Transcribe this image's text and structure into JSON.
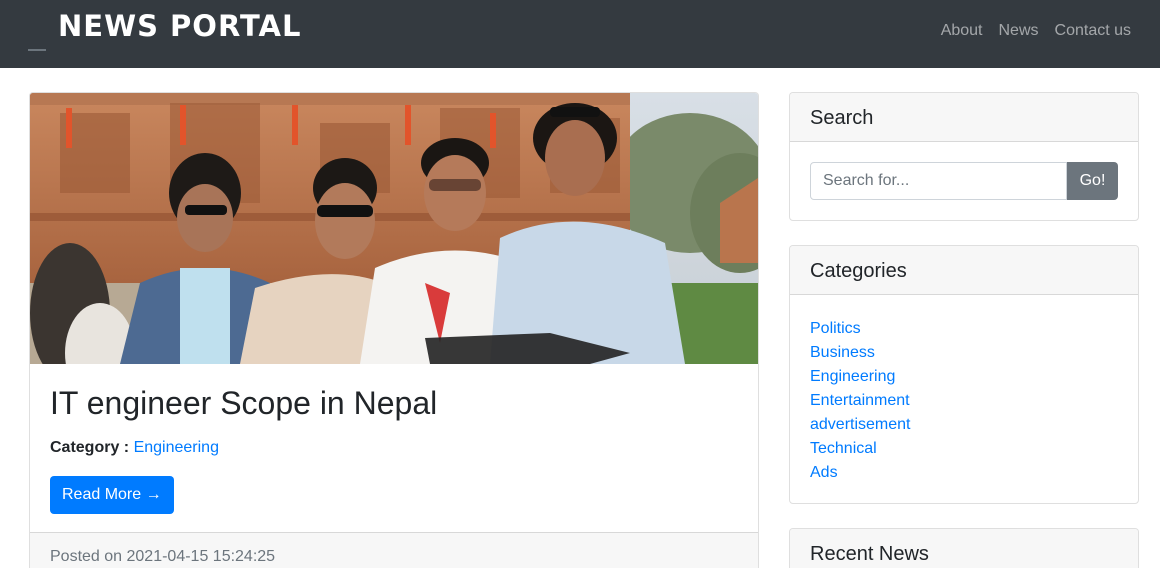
{
  "navbar": {
    "brand": "NEWS PORTAL",
    "links": [
      "About",
      "News",
      "Contact us"
    ]
  },
  "post": {
    "image": "group-photo-four-men-in-front-of-temple",
    "title": "IT engineer Scope in Nepal",
    "category_label": "Category :",
    "category": "Engineering",
    "read_more": "Read More →",
    "posted_on": "Posted on 2021-04-15 15:24:25"
  },
  "search": {
    "heading": "Search",
    "placeholder": "Search for...",
    "button": "Go!"
  },
  "categories": {
    "heading": "Categories",
    "items": [
      "Politics",
      "Business",
      "Engineering",
      "Entertainment",
      "advertisement",
      "Technical",
      "Ads"
    ]
  },
  "recent": {
    "heading": "Recent News"
  },
  "colors": {
    "navbar": "#343a40",
    "primary": "#007bff",
    "secondary": "#6c757d"
  }
}
